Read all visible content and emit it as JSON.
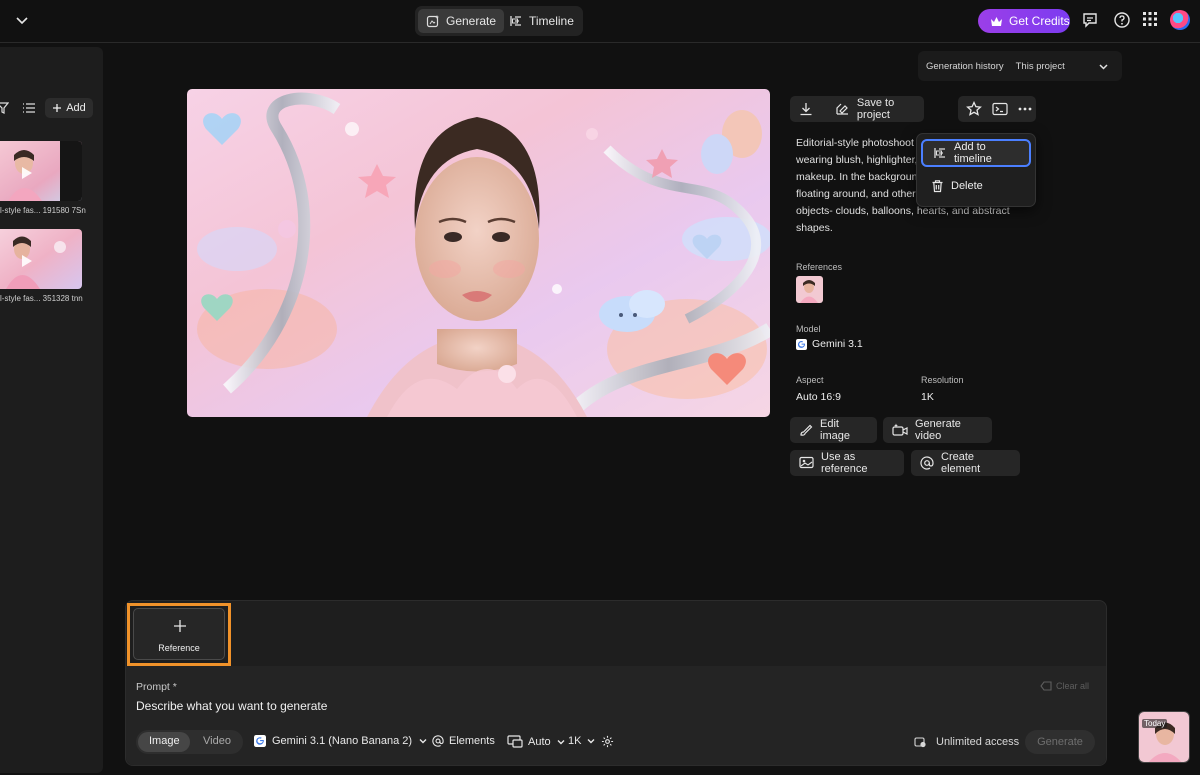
{
  "topbar": {
    "tabs": [
      {
        "label": "Generate",
        "active": true
      },
      {
        "label": "Timeline",
        "active": false
      }
    ],
    "get_credits": "Get Credits",
    "icons": [
      "chevron-down-icon",
      "generate-icon",
      "timeline-icon",
      "crown-icon",
      "chat-icon",
      "help-icon",
      "apps-grid-icon",
      "user-avatar"
    ]
  },
  "left_panel": {
    "add_label": "Add",
    "items": [
      {
        "caption": "l-style fas... 191580 7Sn"
      },
      {
        "caption": "l-style fas... 351328 tnn"
      }
    ]
  },
  "history": {
    "label": "Generation history",
    "scope": "This project"
  },
  "detail": {
    "save_label": "Save to project",
    "description": "Editorial-style photoshoot of a woman wearing blush, highlighter, and glossy lip makeup. In the background there are floating around, and other iridescent objects- clouds, balloons, hearts, and abstract shapes.",
    "description_lines": [
      "Editorial-style photoshoot",
      "wearing blush, highlighter,",
      "makeup. In the background",
      "floating around, and other",
      "objects- clouds, balloons, hearts, and abstract",
      "shapes."
    ],
    "references_label": "References",
    "model_label": "Model",
    "model_value": "Gemini 3.1",
    "aspect_label": "Aspect",
    "aspect_value": "Auto 16:9",
    "resolution_label": "Resolution",
    "resolution_value": "1K",
    "actions": {
      "edit_image": "Edit image",
      "generate_video": "Generate video",
      "use_as_reference": "Use as reference",
      "create_element": "Create element"
    }
  },
  "context_menu": {
    "items": [
      {
        "label": "Add to timeline",
        "selected": true
      },
      {
        "label": "Delete",
        "selected": false
      }
    ]
  },
  "prompt": {
    "reference_label": "Reference",
    "prompt_label": "Prompt *",
    "placeholder": "Describe what you want to generate",
    "clear_all": "Clear all",
    "mode_image": "Image",
    "mode_video": "Video",
    "model": "Gemini 3.1 (Nano Banana 2)",
    "elements": "Elements",
    "aspect": "Auto",
    "resolution": "1K",
    "unlimited": "Unlimited access",
    "generate": "Generate",
    "today_badge": "Today"
  },
  "colors": {
    "accent_orange": "#f0922a",
    "selection_blue": "#4b7fff",
    "credits_purple": "#8b3de9"
  }
}
